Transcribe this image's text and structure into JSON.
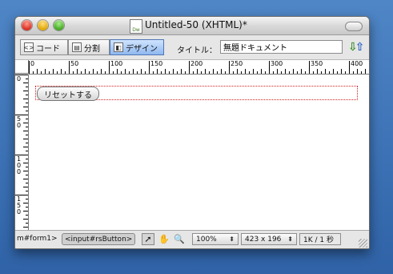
{
  "window": {
    "title": "Untitled-50 (XHTML)*",
    "doc_icon_text": "Dw"
  },
  "toolbar": {
    "view_buttons": [
      {
        "label": "コード",
        "icon": "code-view-icon"
      },
      {
        "label": "分割",
        "icon": "split-view-icon"
      },
      {
        "label": "デザイン",
        "icon": "design-view-icon",
        "active": true
      }
    ],
    "title_label": "タイトル：",
    "title_value": "無題ドキュメント"
  },
  "ruler": {
    "h_labels": [
      "0",
      "50",
      "100",
      "150",
      "200",
      "250",
      "300",
      "350",
      "400"
    ],
    "v_labels": [
      "0",
      "50",
      "100",
      "150"
    ]
  },
  "design": {
    "reset_button_label": "リセットする"
  },
  "status": {
    "tag_path_text": "m#form1>",
    "tag_chip": "<input#rsButton>",
    "zoom": "100%",
    "dimensions": "423 x 196",
    "download": "1K / 1 秒"
  }
}
